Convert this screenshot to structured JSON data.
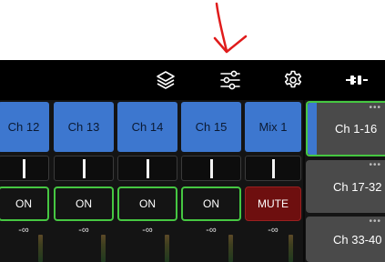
{
  "colors": {
    "accent_blue": "#3d77cf",
    "on_green": "#46c742",
    "mute_red": "#6e0f0f",
    "annotation_red": "#e01b1b"
  },
  "annotation": {
    "icon": "arrow-down-icon"
  },
  "toolbar": {
    "icons": [
      "layers-icon",
      "sliders-icon",
      "gear-icon",
      "plug-connector-icon"
    ]
  },
  "strips": [
    {
      "name": "Ch 12",
      "state": "ON",
      "level": "-∞",
      "pan": 0.5
    },
    {
      "name": "Ch 13",
      "state": "ON",
      "level": "-∞",
      "pan": 0.5
    },
    {
      "name": "Ch 14",
      "state": "ON",
      "level": "-∞",
      "pan": 0.5
    },
    {
      "name": "Ch 15",
      "state": "ON",
      "level": "-∞",
      "pan": 0.5
    },
    {
      "name": "Mix 1",
      "state": "MUTE",
      "level": "-∞",
      "pan": 0.5
    }
  ],
  "banks": [
    {
      "label": "Ch 1-16",
      "active": true
    },
    {
      "label": "Ch 17-32",
      "active": false
    },
    {
      "label": "Ch 33-40",
      "active": false
    }
  ],
  "bank_menu_glyph": "•••"
}
